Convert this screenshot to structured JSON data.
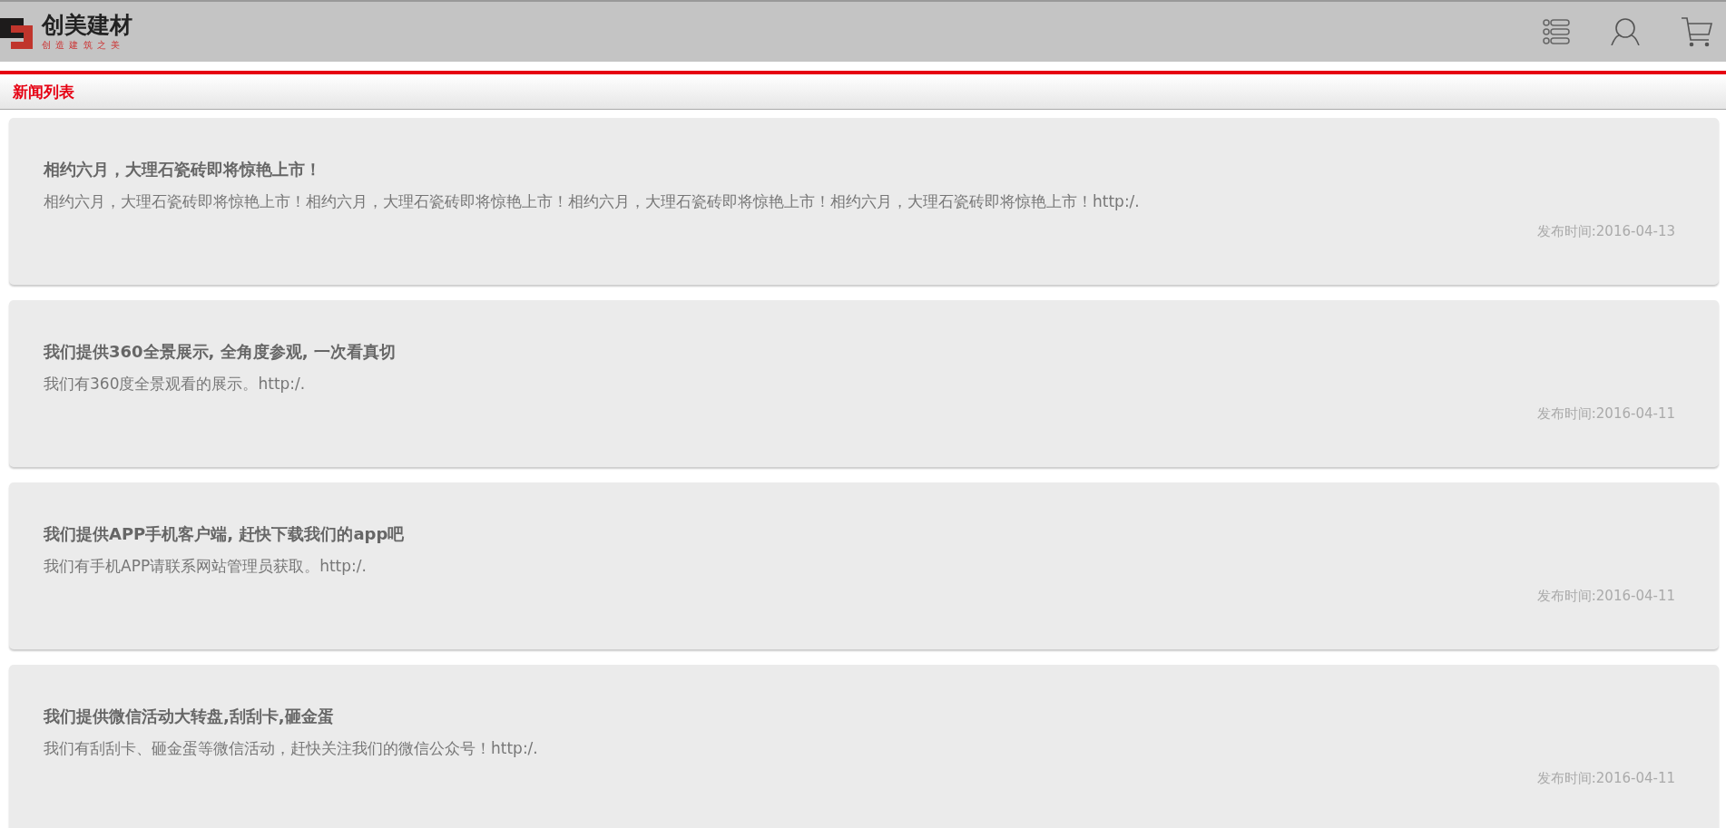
{
  "header": {
    "logo": {
      "name": "创美建材",
      "slogan": "创 造 建 筑 之 美"
    }
  },
  "section": {
    "title": "新闻列表"
  },
  "news": [
    {
      "title": "相约六月，大理石瓷砖即将惊艳上市！",
      "summary": "相约六月，大理石瓷砖即将惊艳上市！相约六月，大理石瓷砖即将惊艳上市！相约六月，大理石瓷砖即将惊艳上市！相约六月，大理石瓷砖即将惊艳上市！http:/.",
      "date": "发布时间:2016-04-13"
    },
    {
      "title": "我们提供360全景展示, 全角度参观, 一次看真切",
      "summary": "我们有360度全景观看的展示。http:/.",
      "date": "发布时间:2016-04-11"
    },
    {
      "title": "我们提供APP手机客户端, 赶快下载我们的app吧",
      "summary": "我们有手机APP请联系网站管理员获取。http:/.",
      "date": "发布时间:2016-04-11"
    },
    {
      "title": "我们提供微信活动大转盘,刮刮卡,砸金蛋",
      "summary": "我们有刮刮卡、砸金蛋等微信活动，赶快关注我们的微信公众号！http:/.",
      "date": "发布时间:2016-04-11"
    }
  ]
}
